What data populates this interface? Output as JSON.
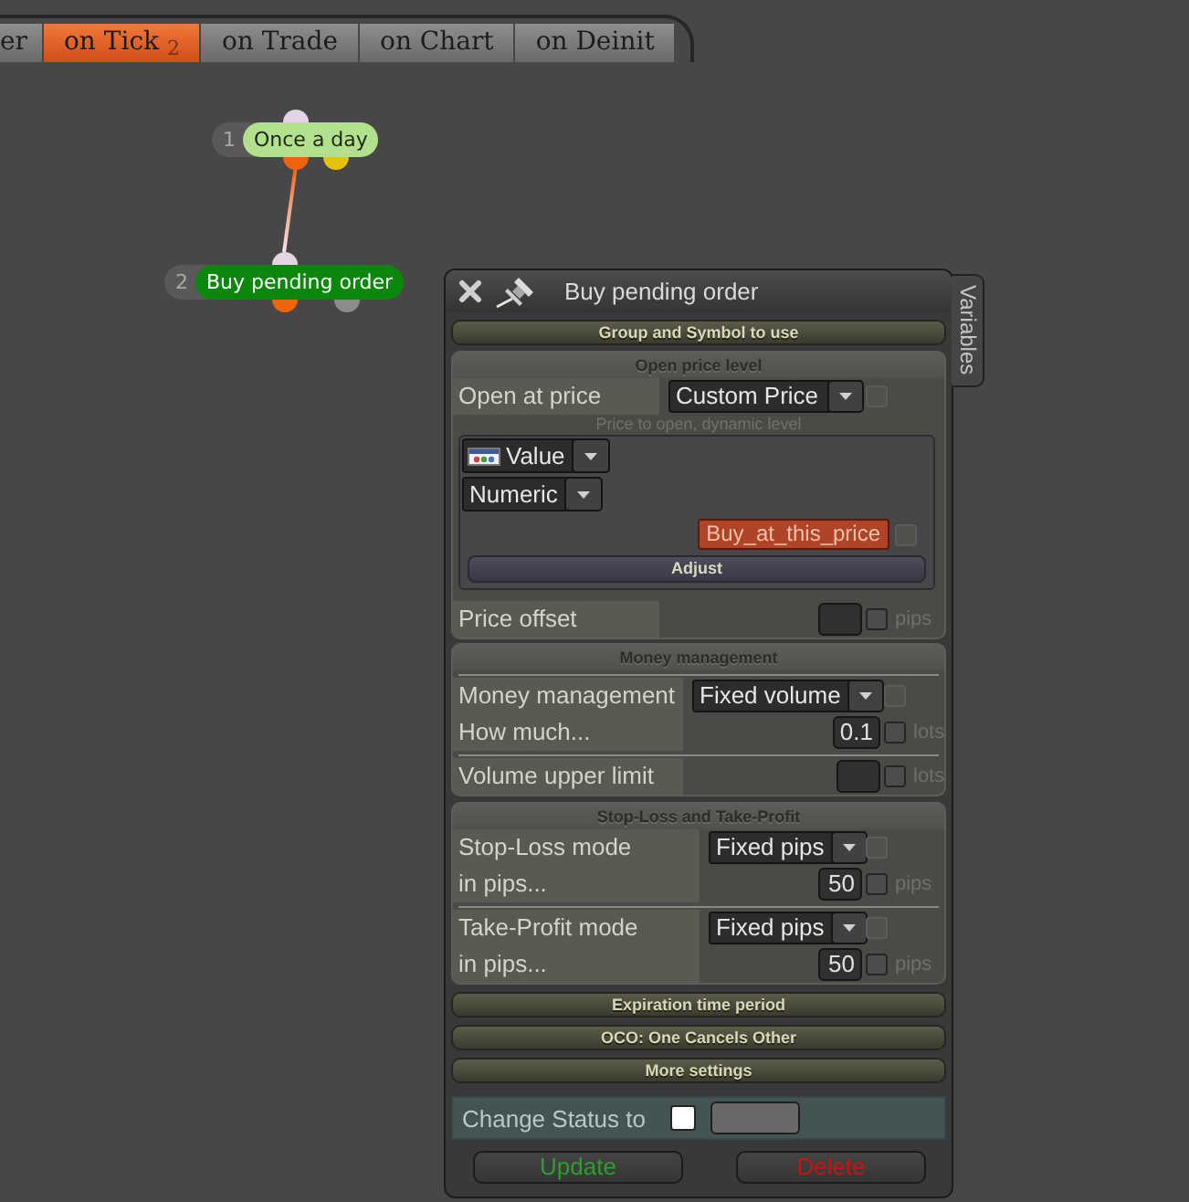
{
  "tabs": [
    {
      "label": "er",
      "selected": false
    },
    {
      "label": "on Tick $_{2}$",
      "selected": true
    },
    {
      "label": "on Trade",
      "selected": false
    },
    {
      "label": "on Chart",
      "selected": false
    },
    {
      "label": "on Deinit",
      "selected": false
    }
  ],
  "diagram": {
    "nodes": [
      {
        "number": "1",
        "label": "Once a day",
        "color": "#b3e08c",
        "outputs": [
          {
            "color": "#ee6410"
          },
          {
            "color": "#e8c010"
          }
        ],
        "children": [
          {
            "number": "2",
            "label": "Buy pending order",
            "color": "#0b870b",
            "outputs": [
              {
                "color": "#ee6410"
              },
              {
                "color": "#8c8c8c"
              }
            ]
          }
        ]
      }
    ]
  },
  "panel": {
    "title": "Buy pending order",
    "side_tab": "Variables",
    "sections": [
      {
        "title": "Group and Symbol to use",
        "expanded": false
      },
      {
        "title": "Open price level",
        "expanded": true,
        "rows": [
          {
            "kind": "select",
            "label": "Open at price",
            "value": "Custom Price",
            "check": {
              "checked": false,
              "disabled": true
            }
          },
          {
            "kind": "hint",
            "text": "Price to open, dynamic level"
          },
          {
            "kind": "group",
            "items": [
              {
                "kind": "select",
                "value": "Value",
                "icon": true
              },
              {
                "kind": "select",
                "value": "Numeric",
                "icon": false
              },
              {
                "kind": "button",
                "label": "Buy_at_this_price",
                "check": {
                  "checked": false,
                  "disabled": true
                }
              },
              {
                "kind": "bar",
                "label": "Adjust"
              }
            ]
          },
          {
            "kind": "number",
            "label": "Price offset",
            "unit": "pips",
            "check": {
              "checked": false,
              "disabled": false
            }
          }
        ]
      },
      {
        "title": "Money management",
        "expanded": true,
        "rows": [
          {
            "kind": "divider"
          },
          {
            "kind": "select",
            "label": "Money management",
            "value": "Fixed volume",
            "check": {
              "checked": false,
              "disabled": true
            }
          },
          {
            "kind": "number",
            "label": "How much...",
            "value": "0.1",
            "unit": "lots",
            "check": {
              "checked": false,
              "disabled": false
            }
          },
          {
            "kind": "divider"
          },
          {
            "kind": "number",
            "label": "Volume upper limit",
            "unit": "lots",
            "check": {
              "checked": false,
              "disabled": false
            }
          }
        ]
      },
      {
        "title": "Stop-Loss and Take-Profit",
        "expanded": true,
        "rows": [
          {
            "kind": "select",
            "label": "Stop-Loss mode",
            "value": "Fixed pips",
            "check": {
              "checked": false,
              "disabled": true
            }
          },
          {
            "kind": "number",
            "label": "in pips...",
            "value": "50",
            "unit": "pips",
            "check": {
              "checked": false,
              "disabled": false
            }
          },
          {
            "kind": "divider"
          },
          {
            "kind": "select",
            "label": "Take-Profit mode",
            "value": "Fixed pips",
            "check": {
              "checked": false,
              "disabled": true
            }
          },
          {
            "kind": "number",
            "label": "in pips...",
            "value": "50",
            "unit": "pips",
            "check": {
              "checked": false,
              "disabled": false
            }
          }
        ]
      },
      {
        "title": "Expiration time period",
        "expanded": false
      },
      {
        "title": "OCO: One Cancels Other",
        "expanded": false
      },
      {
        "title": "More settings",
        "expanded": false
      }
    ],
    "status": {
      "label": "Change Status to",
      "checked": false
    },
    "buttons": [
      {
        "label": "Update",
        "color": "#2e9e2e"
      },
      {
        "label": "Delete",
        "color": "#d01010"
      }
    ]
  }
}
